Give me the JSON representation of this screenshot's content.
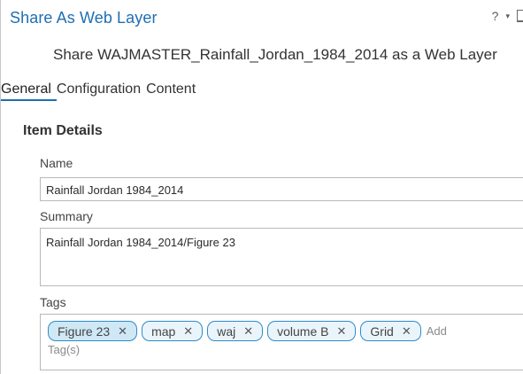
{
  "pane": {
    "title": "Share As Web Layer",
    "help": "?",
    "menu_caret": "▾",
    "subtitle": "Share WAJMASTER_Rainfall_Jordan_1984_2014 as a Web Layer"
  },
  "tabs": [
    {
      "label": "General",
      "active": true
    },
    {
      "label": "Configuration",
      "active": false
    },
    {
      "label": "Content",
      "active": false
    }
  ],
  "item_details": {
    "heading": "Item Details",
    "name_label": "Name",
    "name_value": "Rainfall Jordan 1984_2014",
    "summary_label": "Summary",
    "summary_value": "Rainfall Jordan 1984_2014/Figure 23",
    "tags_label": "Tags",
    "tags": [
      "Figure 23",
      "map",
      "waj",
      "volume B",
      "Grid"
    ],
    "tag_remove_glyph": "✕",
    "add_tag_placeholder_line1": "Add",
    "add_tag_placeholder_line2": "Tag(s)"
  },
  "colors": {
    "accent": "#1f6fb2",
    "chip_border": "#2e8bc9",
    "chip_fill": "#eaf5fb"
  }
}
